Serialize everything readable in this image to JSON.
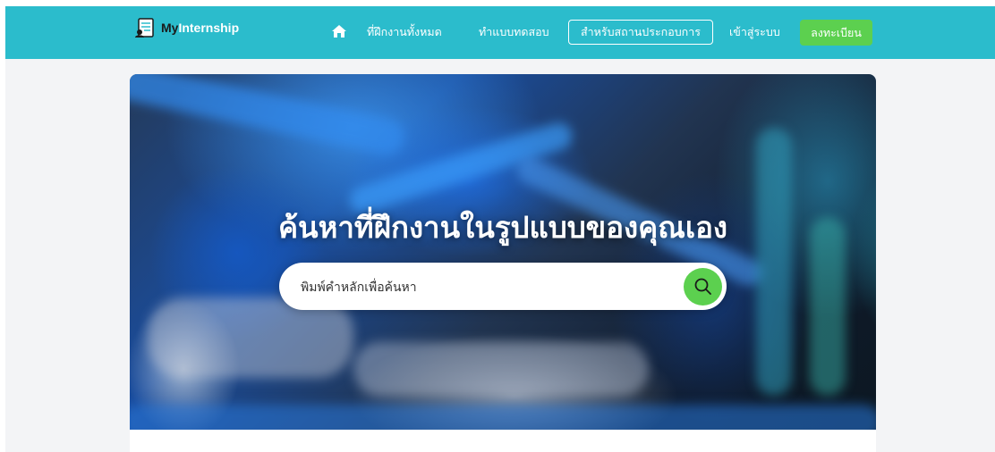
{
  "colors": {
    "navbar_bg": "#2bbccc",
    "accent_green": "#5cd04f",
    "page_bg": "#f3f4f6",
    "text_white": "#ffffff"
  },
  "brand": {
    "prefix": "My",
    "name": "Internship",
    "icon": "document-person-icon"
  },
  "nav": {
    "home_icon": "home-icon",
    "all_internships": "ที่ฝึกงานทั้งหมด",
    "take_test": "ทำแบบทดสอบ",
    "for_companies": "สำหรับสถานประกอบการ",
    "login": "เข้าสู่ระบบ",
    "register": "ลงทะเบียน"
  },
  "hero": {
    "title": "ค้นหาที่ฝึกงานในรูปแบบของคุณเอง",
    "search_placeholder": "พิมพ์คำหลักเพื่อค้นหา",
    "search_icon": "search-icon"
  }
}
